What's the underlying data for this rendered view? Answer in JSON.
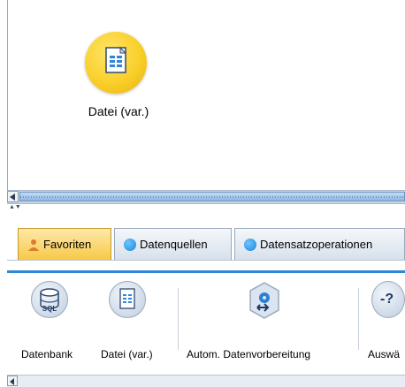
{
  "canvas": {
    "node": {
      "label": "Datei (var.)",
      "icon": "document-icon"
    }
  },
  "palette": {
    "tabs": [
      {
        "label": "Favoriten",
        "icon": "user-icon",
        "active": true
      },
      {
        "label": "Datenquellen",
        "icon": "blue-dot-icon",
        "active": false
      },
      {
        "label": "Datensatzoperationen",
        "icon": "blue-dot-icon",
        "active": false
      }
    ],
    "tools": [
      {
        "label": "Datenbank",
        "icon": "database-sql-icon",
        "badge": "SQL"
      },
      {
        "label": "Datei (var.)",
        "icon": "document-icon"
      },
      {
        "label": "Autom. Datenvorbereitung",
        "icon": "gear-arrow-icon"
      },
      {
        "label": "Auswä",
        "icon": "question-icon",
        "badge": "-?"
      }
    ]
  },
  "colors": {
    "node_fill": "#f9cf2a",
    "active_tab": "#f7c948",
    "panel_accent": "#2f86d6",
    "scroll_thumb": "#8fb6e1"
  }
}
